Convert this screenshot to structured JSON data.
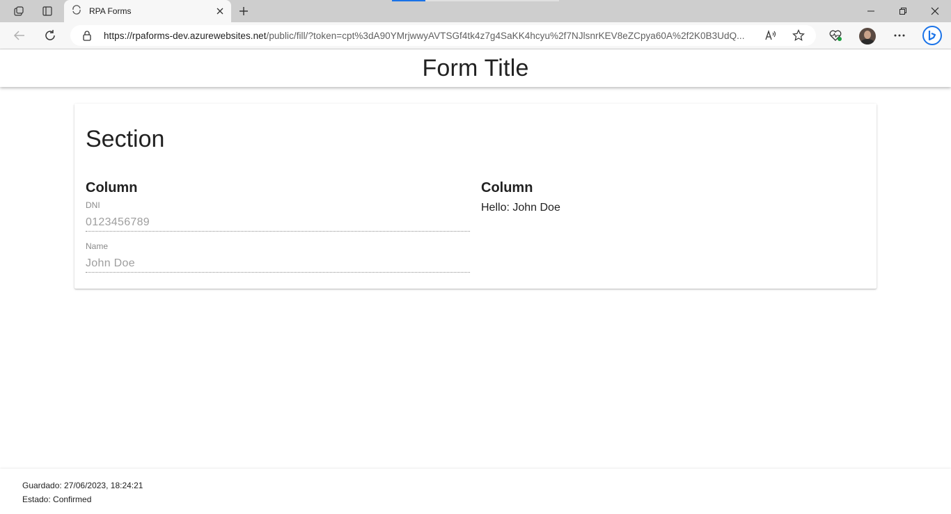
{
  "browser": {
    "tab": {
      "title": "RPA Forms"
    },
    "address": {
      "url_host": "https://rpaforms-dev.azurewebsites.net",
      "url_path": "/public/fill/?token=cpt%3dA90YMrjwwyAVTSGf4tk4z7g4SaKK4hcyu%2f7NJlsnrKEV8eZCpya60A%2f2K0B3UdQ..."
    },
    "icons": {
      "workspaces": "workspaces-icon",
      "tab_actions": "tab-actions-icon",
      "back": "back-arrow-icon",
      "refresh": "refresh-icon",
      "lock": "lock-icon",
      "read_aloud": "read-aloud-icon",
      "favorite": "star-icon",
      "browser_essentials": "heart-pulse-icon",
      "more": "more-icon",
      "bing": "bing-icon"
    }
  },
  "form": {
    "title": "Form Title",
    "section": {
      "title": "Section",
      "columns": [
        {
          "title": "Column",
          "fields": [
            {
              "label": "DNI",
              "value": "0123456789"
            },
            {
              "label": "Name",
              "value": "John Doe"
            }
          ]
        },
        {
          "title": "Column",
          "text": "Hello: John Doe"
        }
      ]
    }
  },
  "footer": {
    "saved": "Guardado: 27/06/2023, 18:24:21",
    "status": "Estado: Confirmed"
  },
  "colors": {
    "accent": "#1a73e8",
    "chrome_bg": "#cecece",
    "toolbar_bg": "#f7f7f7"
  }
}
